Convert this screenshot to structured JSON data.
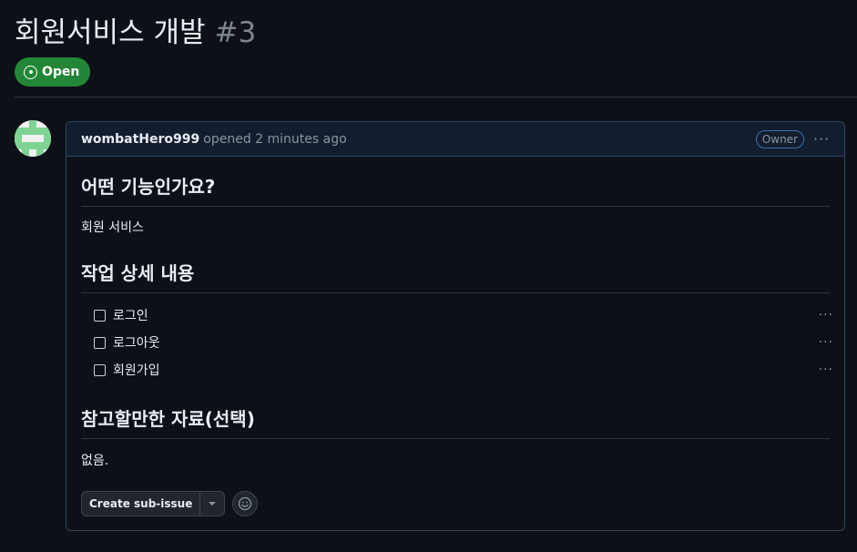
{
  "issue": {
    "title": "회원서비스 개발",
    "number": "#3",
    "state": "Open"
  },
  "comment": {
    "author": "wombatHero999",
    "meta": "opened 2 minutes ago",
    "role_badge": "Owner",
    "sections": [
      {
        "heading": "어떤 기능인가요?",
        "text": "회원 서비스"
      },
      {
        "heading": "작업 상세 내용"
      },
      {
        "heading": "참고할만한 자료(선택)",
        "text": "없음."
      }
    ],
    "tasks": [
      {
        "label": "로그인",
        "checked": false
      },
      {
        "label": "로그아웃",
        "checked": false
      },
      {
        "label": "회원가입",
        "checked": false
      }
    ],
    "actions": {
      "create_sub_issue": "Create sub-issue"
    }
  },
  "colors": {
    "background": "#0d1117",
    "open_green": "#238636",
    "header_bg": "#121d2f"
  },
  "icons": [
    "issue-open-icon",
    "kebab-icon",
    "caret-down-icon",
    "smiley-icon",
    "avatar-identicon"
  ]
}
